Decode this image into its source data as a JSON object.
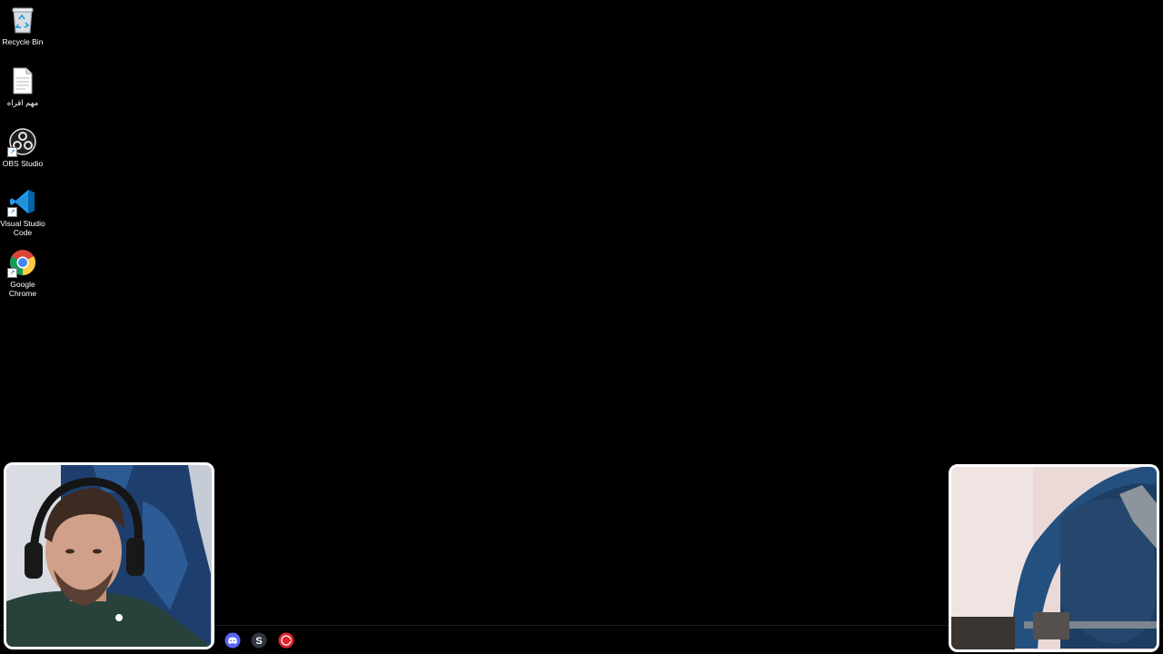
{
  "desktop": {
    "background_color": "#000000",
    "icons": [
      {
        "label": "Recycle Bin",
        "icon": "recycle-bin-icon"
      },
      {
        "label": "مهم اقراه",
        "icon": "text-document-icon"
      },
      {
        "label": "OBS Studio",
        "icon": "obs-studio-icon"
      },
      {
        "label": "Visual Studio Code",
        "icon": "vscode-icon"
      },
      {
        "label": "Google Chrome",
        "icon": "chrome-icon"
      }
    ]
  },
  "taskbar": {
    "apps": [
      {
        "icon": "discord-icon",
        "color": "#5865f2"
      },
      {
        "icon": "steam-s-icon",
        "color": "#2f3640"
      },
      {
        "icon": "red-app-icon",
        "color": "#e0242c"
      }
    ]
  },
  "overlays": {
    "left_camera": {
      "icon": "webcam-person-feed"
    },
    "right_camera": {
      "icon": "webcam-chair-feed"
    }
  }
}
